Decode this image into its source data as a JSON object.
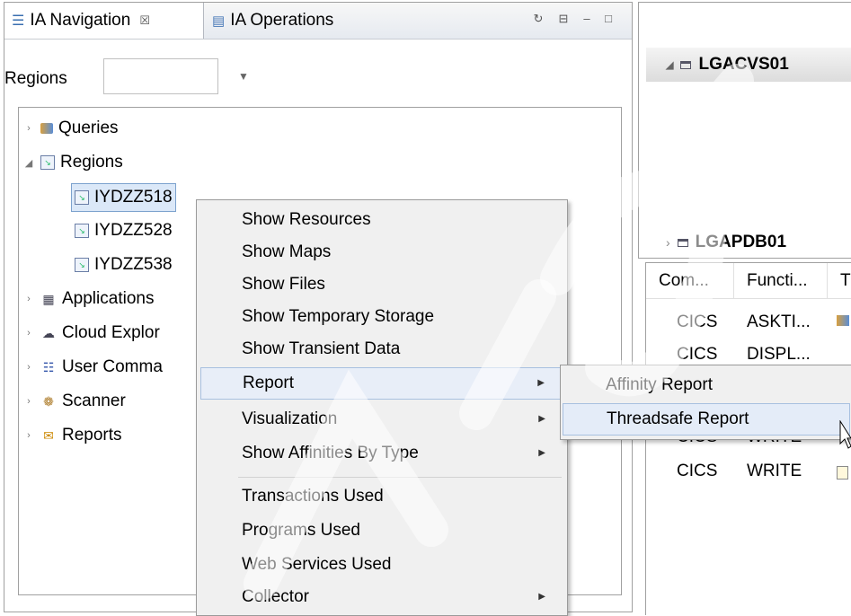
{
  "tabs": [
    {
      "label": "IA Navigation",
      "close": "☒",
      "icon": "navigation-list-icon"
    },
    {
      "label": "IA Operations",
      "icon": "operations-icon"
    }
  ],
  "regions_filter": {
    "label": "Regions",
    "value": ""
  },
  "tree": {
    "queries": "Queries",
    "regions": "Regions",
    "region_items": [
      "IYDZZ518",
      "IYDZZ528",
      "IYDZZ538"
    ],
    "applications": "Applications",
    "cloud": "Cloud Explor",
    "user_commands": "User Comma",
    "scanner": "Scanner",
    "reports": "Reports"
  },
  "right": {
    "group1": "LGACVS01",
    "group2": "LGAPDB01",
    "table": {
      "headers": [
        "Com...",
        "Functi...",
        "T"
      ],
      "rows": [
        [
          "CICS",
          "ASKTI..."
        ],
        [
          "CICS",
          "DISPL..."
        ],
        [
          "CICS",
          "WRITE"
        ],
        [
          "CICS",
          "WRITE"
        ]
      ]
    }
  },
  "context_menu": {
    "items": [
      "Show Resources",
      "Show Maps",
      "Show Files",
      "Show Temporary Storage",
      "Show Transient Data",
      "Report",
      "Visualization",
      "Show Affinities By Type",
      "Transactions Used",
      "Programs Used",
      "Web Services Used",
      "Collector"
    ]
  },
  "submenu": {
    "items": [
      "Affinity Report",
      "Threadsafe Report"
    ]
  },
  "colors": {
    "accent": "#7da2ce",
    "highlight": "#e4ecf8",
    "menu_bg": "#f0f0f0"
  }
}
